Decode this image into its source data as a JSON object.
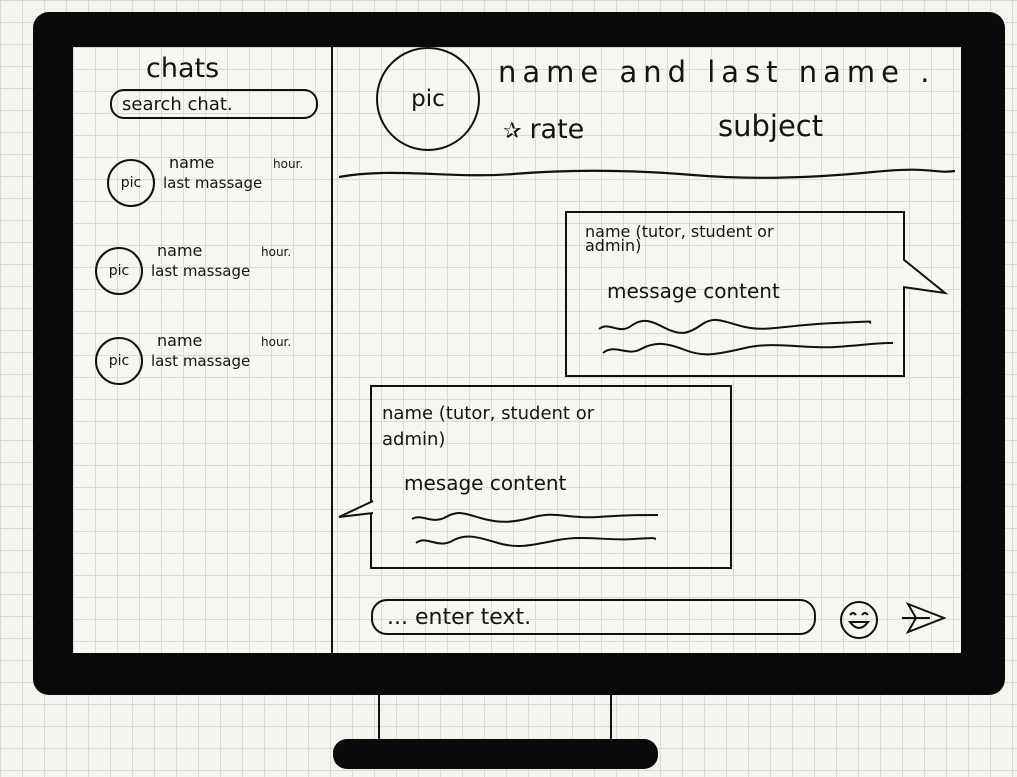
{
  "sidebar": {
    "title": "chats",
    "search_placeholder": "search chat.",
    "chats": [
      {
        "pic": "pic",
        "name": "name",
        "hour": "hour.",
        "last": "last massage"
      },
      {
        "pic": "pic",
        "name": "name",
        "hour": "hour.",
        "last": "last massage"
      },
      {
        "pic": "pic",
        "name": "name",
        "hour": "hour.",
        "last": "last massage"
      }
    ]
  },
  "header": {
    "pic": "pic",
    "name": "name and last name .",
    "rate": "rate",
    "rate_icon": "star-icon",
    "subject": "subject"
  },
  "messages": [
    {
      "who": "name (tutor, student or\n                                        admin)",
      "content": "message content"
    },
    {
      "who": "name (tutor, student or\n                   admin)",
      "content": "mesage content"
    }
  ],
  "composer": {
    "placeholder": "... enter text.",
    "emoji_icon": "smiley-icon",
    "send_icon": "send-icon"
  }
}
